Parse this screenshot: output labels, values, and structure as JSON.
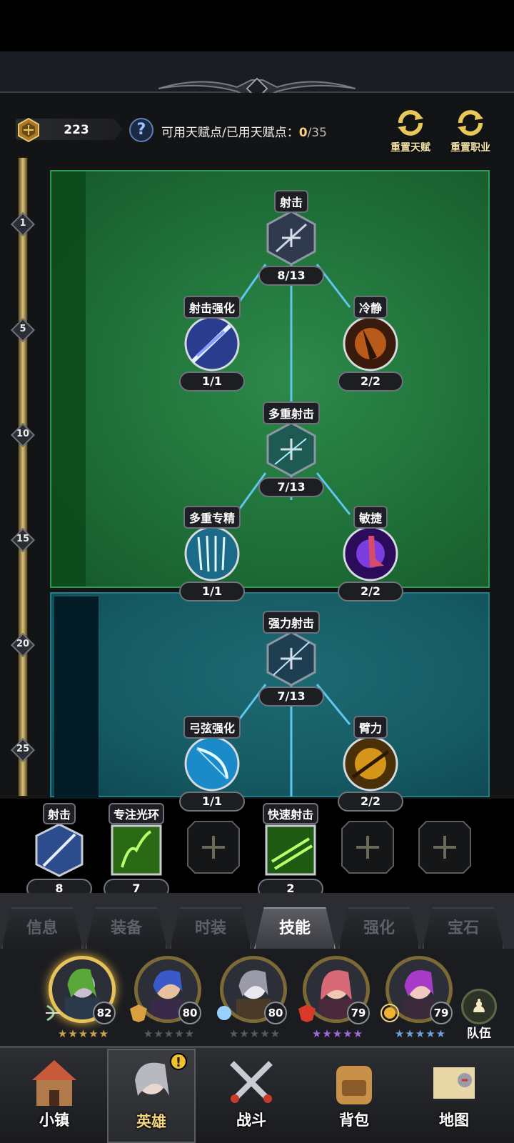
{
  "header": {
    "points_value": "223",
    "talent_label": "可用天赋点/已用天赋点：",
    "talent_used": "0",
    "talent_total": "/35",
    "reset_talent_label": "重置天赋",
    "reset_class_label": "重置职业"
  },
  "rail_levels": [
    "1",
    "5",
    "10",
    "15",
    "20",
    "25"
  ],
  "skill_tree": [
    {
      "name": "射击",
      "count": "8/13",
      "shape": "hex"
    },
    {
      "name": "射击强化",
      "count": "1/1",
      "shape": "circle"
    },
    {
      "name": "冷静",
      "count": "2/2",
      "shape": "circle"
    },
    {
      "name": "多重射击",
      "count": "7/13",
      "shape": "hex"
    },
    {
      "name": "多重专精",
      "count": "1/1",
      "shape": "circle"
    },
    {
      "name": "敏捷",
      "count": "2/2",
      "shape": "circle"
    },
    {
      "name": "强力射击",
      "count": "7/13",
      "shape": "hex"
    },
    {
      "name": "弓弦强化",
      "count": "1/1",
      "shape": "circle"
    },
    {
      "name": "臂力",
      "count": "2/2",
      "shape": "circle"
    }
  ],
  "equipped": [
    {
      "name": "射击",
      "count": "8"
    },
    {
      "name": "专注光环",
      "count": "7"
    },
    {
      "name": "",
      "count": ""
    },
    {
      "name": "快速射击",
      "count": "2"
    },
    {
      "name": "",
      "count": ""
    },
    {
      "name": "",
      "count": ""
    }
  ],
  "tabs": [
    "信息",
    "装备",
    "时装",
    "技能",
    "强化",
    "宝石"
  ],
  "active_tab": "技能",
  "heroes": [
    {
      "level": "82",
      "stars": "★★★★★",
      "star_color": "#c9a14a"
    },
    {
      "level": "80",
      "stars": "★★★★★",
      "star_color": "#555a62"
    },
    {
      "level": "80",
      "stars": "★★★★★",
      "star_color": "#555a62"
    },
    {
      "level": "79",
      "stars": "★★★★★",
      "star_color": "#9a6ad8"
    },
    {
      "level": "79",
      "stars": "★★★★★",
      "star_color": "#6ea0d8"
    }
  ],
  "team_label": "队伍",
  "nav": [
    "小镇",
    "英雄",
    "战斗",
    "背包",
    "地图"
  ],
  "active_nav": "英雄",
  "colors": {
    "panel_green": "#1f7038",
    "panel_teal": "#155a63",
    "gold": "#e6c35a"
  }
}
